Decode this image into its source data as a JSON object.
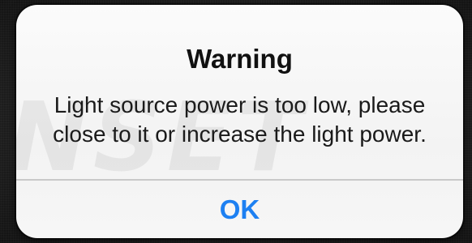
{
  "alert": {
    "title": "Warning",
    "message_lines": [
      "Light source power is too low, please",
      "close to it or increase the light power."
    ],
    "ok_label": "OK",
    "watermark": "NSET"
  },
  "colors": {
    "button_text": "#1d80f2",
    "alert_background": "#f6f6f6",
    "backdrop": "#222222"
  }
}
